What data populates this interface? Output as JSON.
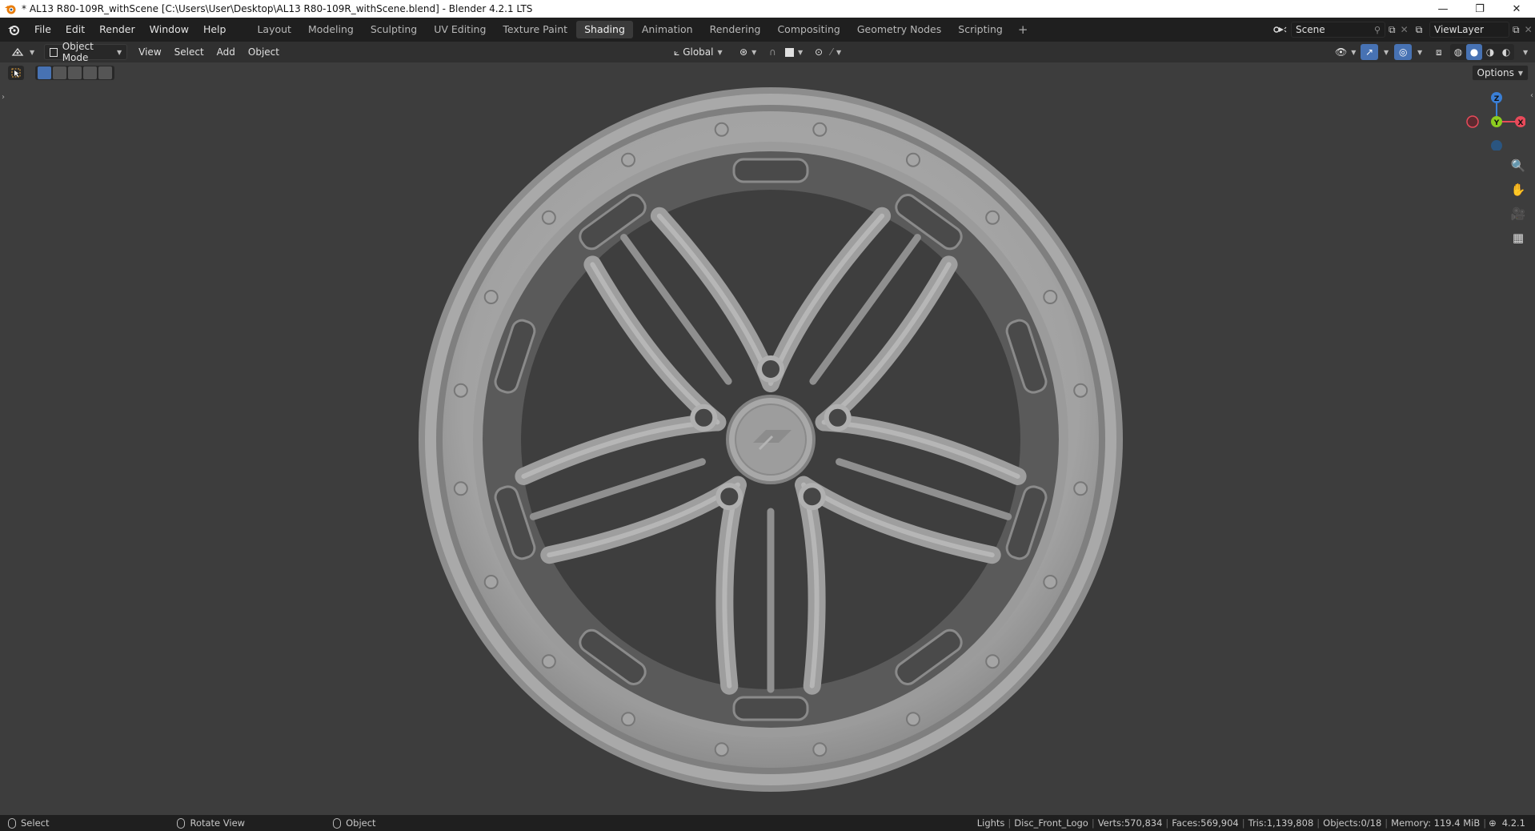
{
  "window": {
    "title": "* AL13 R80-109R_withScene [C:\\Users\\User\\Desktop\\AL13 R80-109R_withScene.blend] - Blender 4.2.1 LTS",
    "controls": [
      "—",
      "❐",
      "✕"
    ]
  },
  "menu": {
    "items": [
      "File",
      "Edit",
      "Render",
      "Window",
      "Help"
    ]
  },
  "workspaces": {
    "tabs": [
      "Layout",
      "Modeling",
      "Sculpting",
      "UV Editing",
      "Texture Paint",
      "Shading",
      "Animation",
      "Rendering",
      "Compositing",
      "Geometry Nodes",
      "Scripting"
    ],
    "active": "Shading",
    "add": "+"
  },
  "scene": {
    "label": "Scene"
  },
  "view_layer": {
    "label": "ViewLayer"
  },
  "header": {
    "mode": "Object Mode",
    "menus": [
      "View",
      "Select",
      "Add",
      "Object"
    ],
    "orientation": "Global",
    "options": "Options"
  },
  "gizmo": {
    "z": "Z",
    "y": "Y",
    "x": "X"
  },
  "status": {
    "select": "Select",
    "rotate": "Rotate View",
    "object": "Object",
    "stats": [
      "Lights",
      "Disc_Front_Logo",
      "Verts:570,834",
      "Faces:569,904",
      "Tris:1,139,808",
      "Objects:0/18",
      "Memory: 119.4 MiB"
    ],
    "version": "4.2.1"
  },
  "colors": {
    "active_tab": "#3a3a3a",
    "axis_x": "#e84a5a",
    "axis_y": "#8ccc1f",
    "axis_z": "#3a7fd6",
    "wheel": "#a3a3a3"
  }
}
